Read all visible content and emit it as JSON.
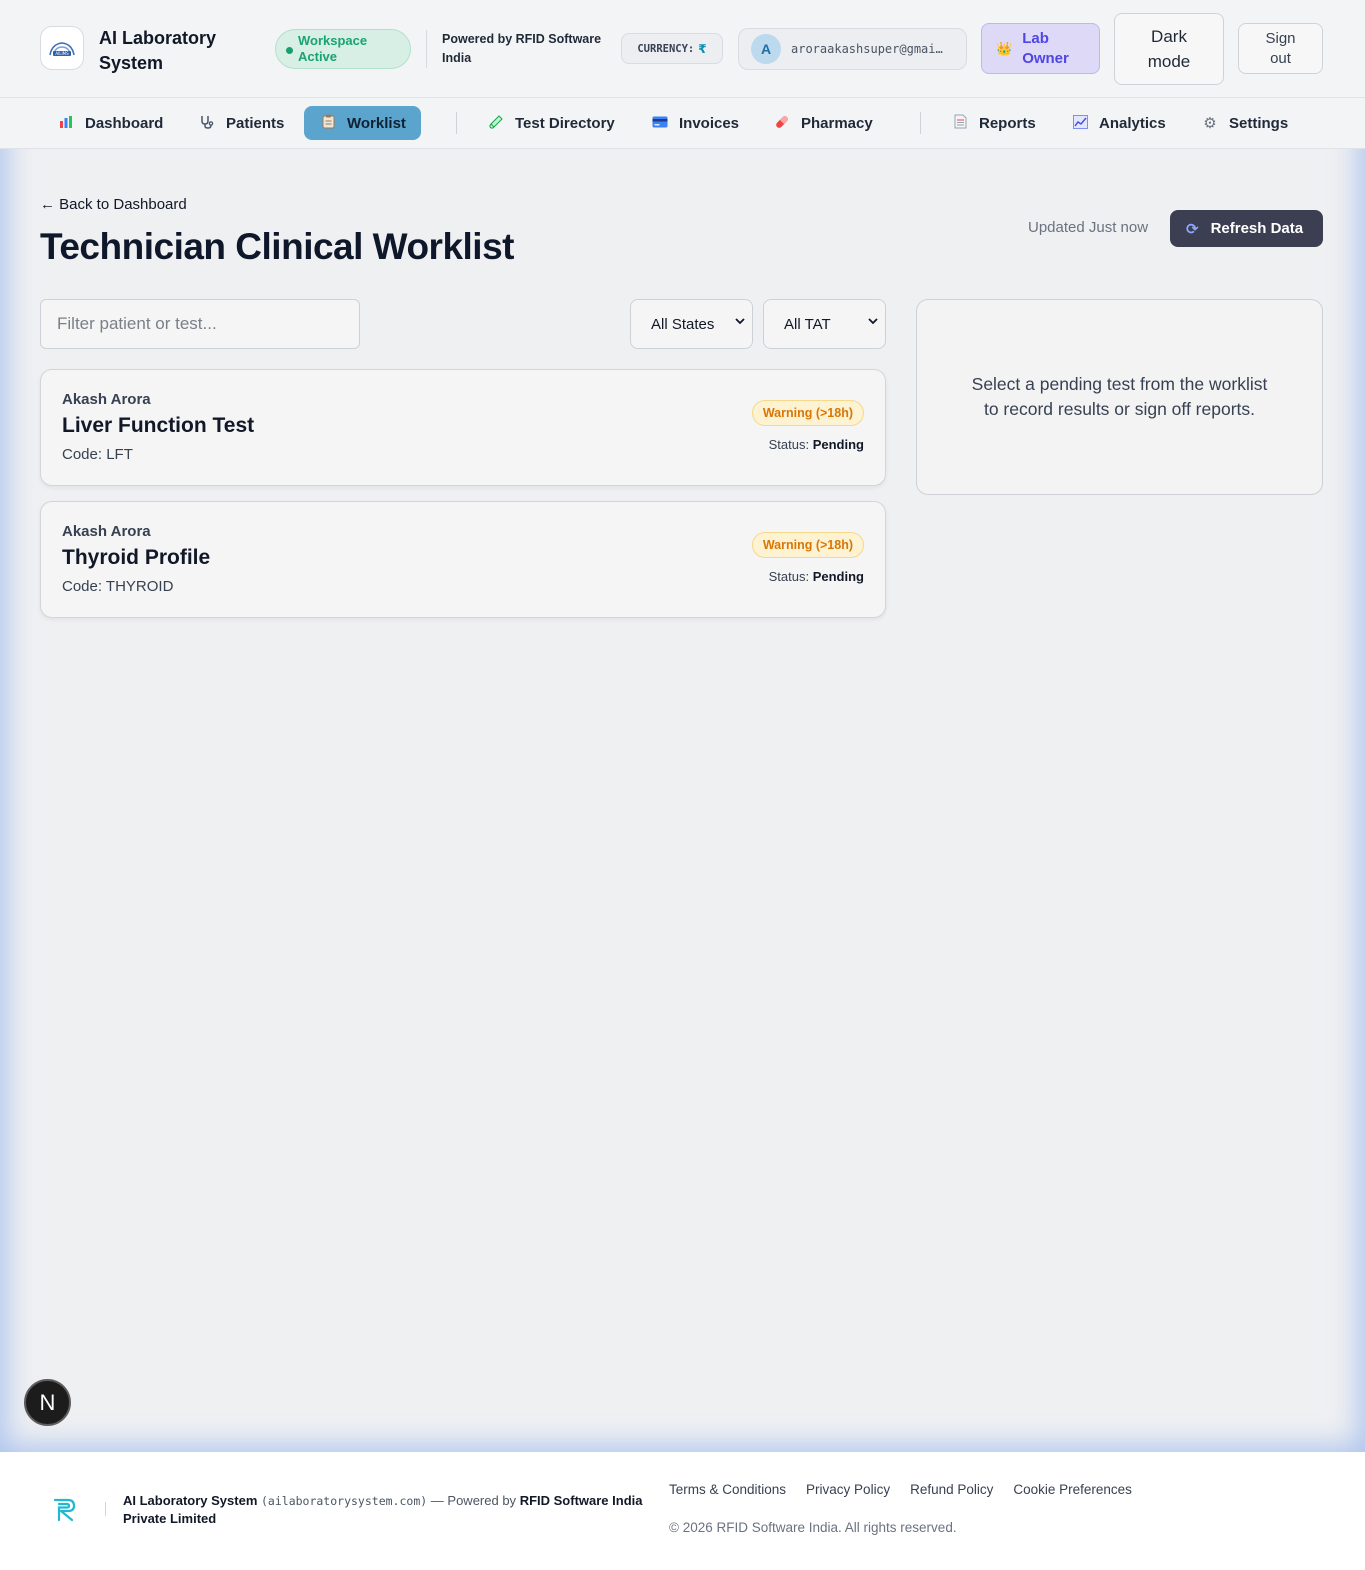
{
  "header": {
    "brand": "AI Laboratory System",
    "workspace_status": "Workspace Active",
    "powered_by": "Powered by RFID Software India",
    "currency_label": "CURRENCY:",
    "currency_symbol": "₹",
    "avatar_initial": "A",
    "email": "aroraakashsuper@gmai…",
    "role_label": "Lab Owner",
    "dark_mode_label": "Dark mode",
    "sign_out_label": "Sign out"
  },
  "nav": {
    "items": [
      {
        "label": "Dashboard",
        "icon": "bar-chart-icon"
      },
      {
        "label": "Patients",
        "icon": "stethoscope-icon"
      },
      {
        "label": "Worklist",
        "icon": "clipboard-icon",
        "active": true
      },
      {
        "label": "Test Directory",
        "icon": "test-tube-icon"
      },
      {
        "label": "Invoices",
        "icon": "credit-card-icon"
      },
      {
        "label": "Pharmacy",
        "icon": "pill-icon"
      },
      {
        "label": "Reports",
        "icon": "document-icon"
      },
      {
        "label": "Analytics",
        "icon": "line-chart-icon"
      },
      {
        "label": "Settings",
        "icon": "gear-icon"
      }
    ]
  },
  "page": {
    "back_link": "← Back to Dashboard",
    "title": "Technician Clinical Worklist",
    "updated": "Updated Just now",
    "refresh_label": "Refresh Data"
  },
  "filters": {
    "search_placeholder": "Filter patient or test...",
    "state_selected": "All States",
    "tat_selected": "All TAT"
  },
  "worklist": [
    {
      "patient": "Akash Arora",
      "test": "Liver Function Test",
      "code": "Code: LFT",
      "warning": "Warning (>18h)",
      "status_label": "Status:",
      "status": "Pending"
    },
    {
      "patient": "Akash Arora",
      "test": "Thyroid Profile",
      "code": "Code: THYROID",
      "warning": "Warning (>18h)",
      "status_label": "Status:",
      "status": "Pending"
    }
  ],
  "side_panel": {
    "message": "Select a pending test from the worklist to record results or sign off reports."
  },
  "badge": {
    "letter": "N"
  },
  "footer": {
    "brand": "AI Laboratory System",
    "domain": "(ailaboratorysystem.com)",
    "powered_prefix": "— Powered by",
    "company": "RFID Software India Private Limited",
    "links": [
      "Terms & Conditions",
      "Privacy Policy",
      "Refund Policy",
      "Cookie Preferences"
    ],
    "copyright": "© 2026 RFID Software India. All rights reserved."
  },
  "colors": {
    "accent": "#5aa4cd",
    "warning": "#d97706",
    "success": "#18a370",
    "role": "#4f46e5",
    "button_dark": "#3b3f51"
  }
}
